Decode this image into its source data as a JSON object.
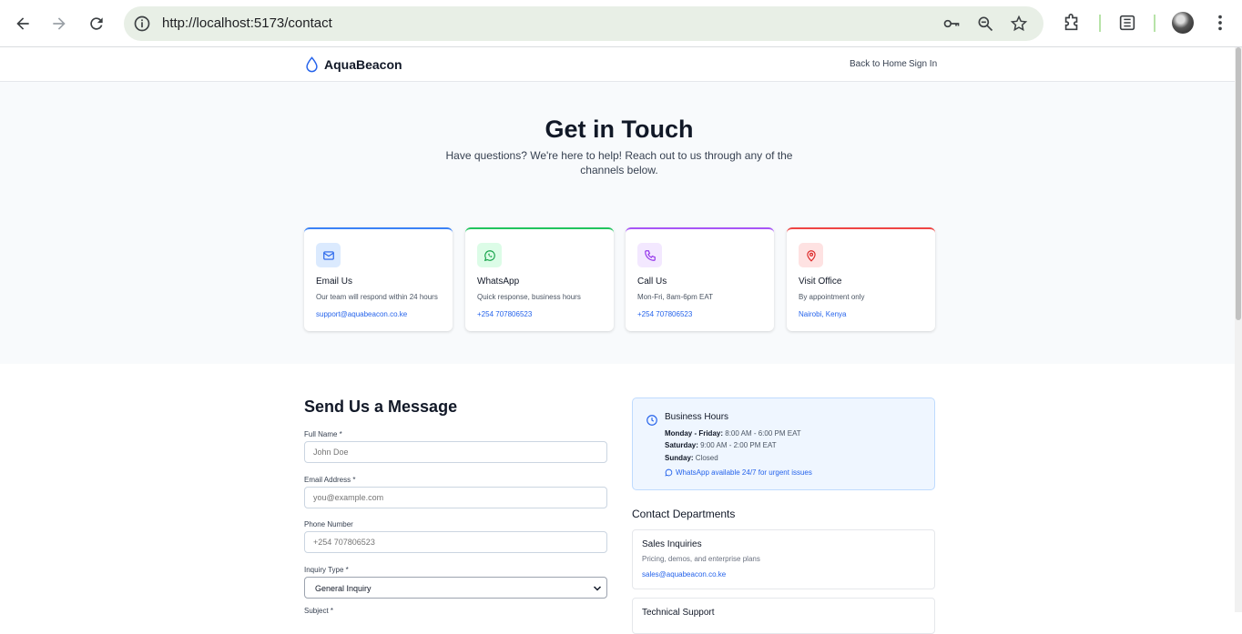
{
  "browser": {
    "url": "http://localhost:5173/contact"
  },
  "header": {
    "brand": "AquaBeacon",
    "back_home": "Back to Home",
    "sign_in": "Sign In"
  },
  "hero": {
    "title": "Get in Touch",
    "subtitle": "Have questions? We're here to help! Reach out to us through any of the channels below."
  },
  "cards": [
    {
      "title": "Email Us",
      "desc": "Our team will respond within 24 hours",
      "link": "support@aquabeacon.co.ke",
      "icon": "mail-icon",
      "accent": "#3b82f6",
      "bg": "#dbeafe"
    },
    {
      "title": "WhatsApp",
      "desc": "Quick response, business hours",
      "link": "+254 707806523",
      "icon": "whatsapp-icon",
      "accent": "#22c55e",
      "bg": "#dcfce7"
    },
    {
      "title": "Call Us",
      "desc": "Mon-Fri, 8am-6pm EAT",
      "link": "+254 707806523",
      "icon": "phone-icon",
      "accent": "#a855f7",
      "bg": "#f3e8ff"
    },
    {
      "title": "Visit Office",
      "desc": "By appointment only",
      "link": "Nairobi, Kenya",
      "icon": "map-pin-icon",
      "accent": "#ef4444",
      "bg": "#fee2e2"
    }
  ],
  "form": {
    "title": "Send Us a Message",
    "full_name_label": "Full Name *",
    "full_name_placeholder": "John Doe",
    "email_label": "Email Address *",
    "email_placeholder": "you@example.com",
    "phone_label": "Phone Number",
    "phone_placeholder": "+254 707806523",
    "inquiry_label": "Inquiry Type *",
    "inquiry_value": "General Inquiry",
    "subject_label": "Subject *"
  },
  "business_hours": {
    "title": "Business Hours",
    "rows": [
      {
        "day": "Monday - Friday:",
        "time": "8:00 AM - 6:00 PM EAT"
      },
      {
        "day": "Saturday:",
        "time": "9:00 AM - 2:00 PM EAT"
      },
      {
        "day": "Sunday:",
        "time": "Closed"
      }
    ],
    "whatsapp_note": "WhatsApp available 24/7 for urgent issues"
  },
  "departments": {
    "title": "Contact Departments",
    "items": [
      {
        "name": "Sales Inquiries",
        "desc": "Pricing, demos, and enterprise plans",
        "email": "sales@aquabeacon.co.ke"
      },
      {
        "name": "Technical Support",
        "desc": "",
        "email": ""
      }
    ]
  }
}
